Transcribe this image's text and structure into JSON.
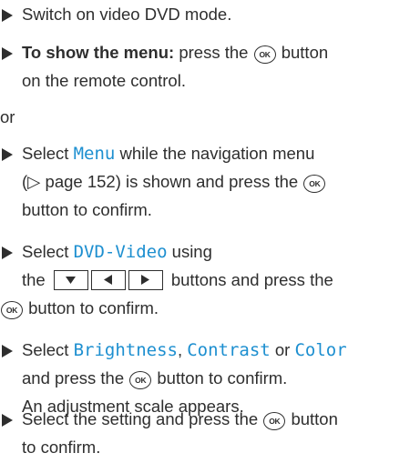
{
  "ok_label": "OK",
  "icons": {
    "bullet": "triangle-right-bullet",
    "ok": "ok-button-symbol",
    "down": "down-arrow-key",
    "left": "left-arrow-key",
    "right": "right-arrow-key"
  },
  "colors": {
    "text": "#2e2e2e",
    "highlight": "#1d8fd0"
  },
  "steps": {
    "s1": {
      "text": "Switch on video DVD mode."
    },
    "s2": {
      "bold": "To show the menu:",
      "a": " press the ",
      "b": " button",
      "l2": "on the remote control."
    },
    "or": "or",
    "s3": {
      "a": "Select ",
      "hl": "Menu",
      "b": " while the navigation menu",
      "l2": "(▷ page 152) is shown and press the",
      "l3b": " button to confirm."
    },
    "s4": {
      "a": "Select ",
      "hl": "DVD-Video",
      "b": " using",
      "l2a": "the ",
      "l2b": "buttons and press the",
      "l3b": " button to confirm."
    },
    "s5": {
      "a": "Select ",
      "hl1": "Brightness",
      "c1": ", ",
      "hl2": "Contrast",
      "c2": " or ",
      "hl3": "Color",
      "l2a": "and press the ",
      "l2b": " button to confirm.",
      "l3": "An adjustment scale appears."
    },
    "s6": {
      "a": "Select the setting and press the ",
      "b": " button",
      "l2": "to confirm."
    }
  }
}
